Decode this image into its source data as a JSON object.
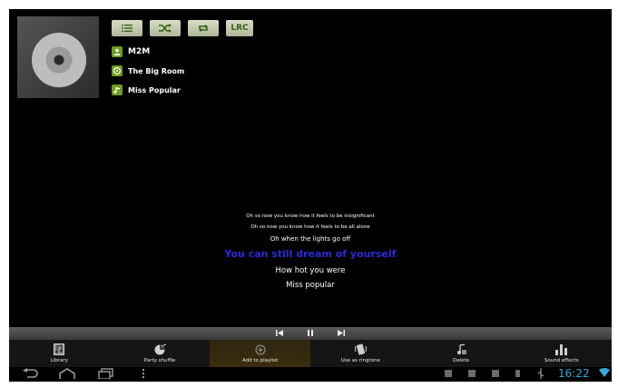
{
  "now_playing": {
    "title": "M2M",
    "album": "The Big Room",
    "song": "Miss Popular"
  },
  "controls": {
    "playlist_icon": "list-icon",
    "shuffle_icon": "shuffle-icon",
    "repeat_icon": "repeat-icon",
    "lyrics_label": "LRC"
  },
  "lyrics": {
    "lines": [
      "Oh so now you know how it feels to be insignificant",
      "Oh so now you know how it feels to be all alone",
      "Oh when the lights go off",
      "You can still dream of yourself",
      "How hot you were",
      "Miss popular"
    ],
    "current_index": 3,
    "current_color": "#2b2bd8"
  },
  "toolbar": {
    "items": [
      {
        "label": "Library",
        "icon": "library-icon"
      },
      {
        "label": "Party shuffle",
        "icon": "party-shuffle-icon"
      },
      {
        "label": "Add to playlist",
        "icon": "add-icon"
      },
      {
        "label": "Use as ringtone",
        "icon": "ringtone-icon"
      },
      {
        "label": "Delete",
        "icon": "delete-icon"
      },
      {
        "label": "Sound effects",
        "icon": "equalizer-icon"
      }
    ],
    "selected_index": 2
  },
  "statusbar": {
    "time": "16:22",
    "accent_color": "#3aa7d8"
  }
}
